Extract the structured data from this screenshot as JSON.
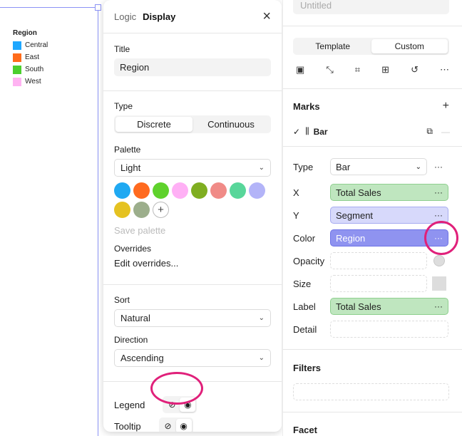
{
  "legend": {
    "title": "Region",
    "items": [
      {
        "label": "Central",
        "color": "#1ea7ff"
      },
      {
        "label": "East",
        "color": "#ff6b1a"
      },
      {
        "label": "South",
        "color": "#4ccf2e"
      },
      {
        "label": "West",
        "color": "#ffb3f2"
      }
    ]
  },
  "popover": {
    "tab_logic": "Logic",
    "tab_display": "Display",
    "close_icon": "×",
    "title_label": "Title",
    "title_value": "Region",
    "type_label": "Type",
    "type_discrete": "Discrete",
    "type_continuous": "Continuous",
    "palette_label": "Palette",
    "palette_value": "Light",
    "palette_colors": [
      "#20a9f2",
      "#ff6a1f",
      "#5fd22c",
      "#ffb0f5",
      "#7fae21",
      "#f08b87",
      "#58d69a",
      "#b3b4f8",
      "#e5c221",
      "#9cae8c"
    ],
    "add_color": "+",
    "save_palette": "Save palette",
    "overrides_label": "Overrides",
    "edit_overrides": "Edit overrides...",
    "sort_label": "Sort",
    "sort_value": "Natural",
    "direction_label": "Direction",
    "direction_value": "Ascending",
    "legend_label": "Legend",
    "tooltip_label": "Tooltip",
    "hide_icon": "⊘",
    "show_icon": "◉"
  },
  "right": {
    "title_placeholder": "Untitled",
    "seg_template": "Template",
    "seg_custom": "Custom",
    "toolbar_icons": [
      "▣",
      "⤡",
      "⌗",
      "⊞",
      "↺",
      "⋯"
    ],
    "marks_label": "Marks",
    "mark_check": "✓",
    "mark_icon": "⫼",
    "mark_name": "Bar",
    "copy_icon": "⧉",
    "minus_icon": "—",
    "enc": {
      "type_k": "Type",
      "type_v": "Bar",
      "x_k": "X",
      "x_v": "Total Sales",
      "y_k": "Y",
      "y_v": "Segment",
      "color_k": "Color",
      "color_v": "Region",
      "opacity_k": "Opacity",
      "size_k": "Size",
      "label_k": "Label",
      "label_v": "Total Sales",
      "detail_k": "Detail"
    },
    "dots": "···",
    "filters_label": "Filters",
    "facet_label": "Facet",
    "plus": "+"
  }
}
